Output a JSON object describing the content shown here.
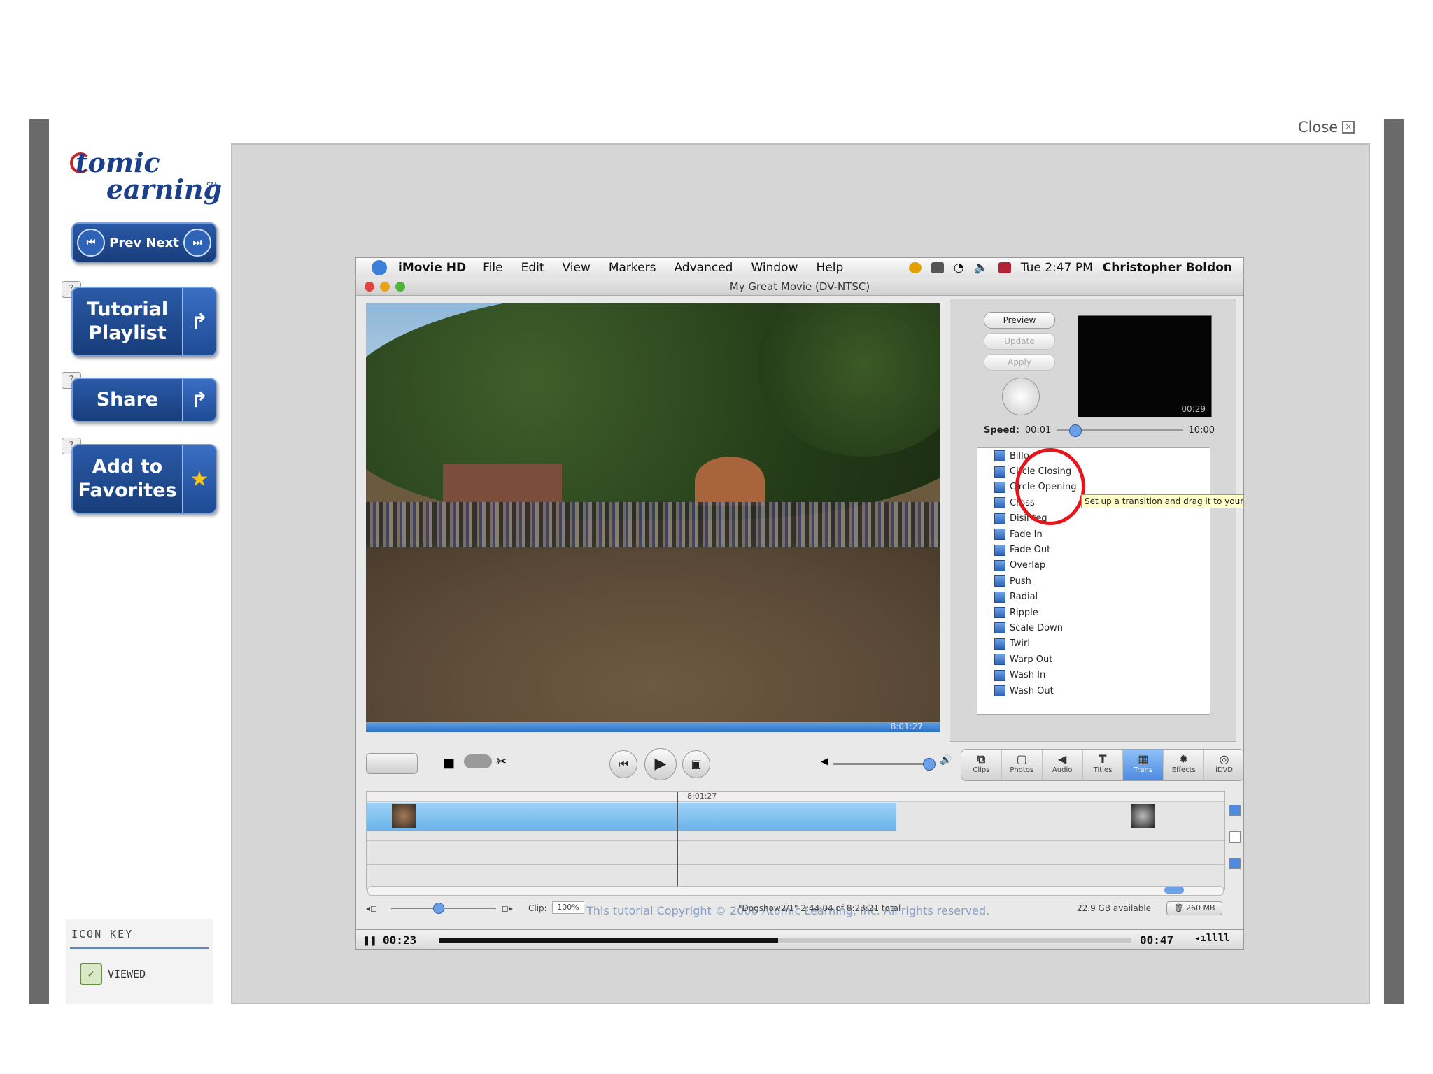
{
  "close": {
    "label": "Close"
  },
  "logo": {
    "line1": "tomic",
    "line2": "earning",
    "tm": "SM"
  },
  "pager": {
    "prev": "Prev",
    "next": "Next"
  },
  "buttons": {
    "tutorial": [
      "Tutorial",
      "Playlist"
    ],
    "share": "Share",
    "favorites": [
      "Add to",
      "Favorites"
    ]
  },
  "icon_key": {
    "title": "ICON KEY",
    "viewed": "VIEWED"
  },
  "mac_menu": {
    "app": "iMovie HD",
    "items": [
      "File",
      "Edit",
      "View",
      "Markers",
      "Advanced",
      "Window",
      "Help"
    ],
    "clock": "Tue 2:47 PM",
    "user": "Christopher Boldon"
  },
  "window": {
    "title": "My Great Movie (DV-NTSC)"
  },
  "viewer": {
    "timecode": "8:01:27"
  },
  "transitions_pane": {
    "buttons": {
      "preview": "Preview",
      "update": "Update",
      "apply": "Apply"
    },
    "preview_time": "00:29",
    "speed_label": "Speed:",
    "speed_value": "00:01",
    "speed_max": "10:00",
    "items": [
      "Billo",
      "Circle Closing",
      "Circle Opening",
      "Cross",
      "Disinteg",
      "Fade In",
      "Fade Out",
      "Overlap",
      "Push",
      "Radial",
      "Ripple",
      "Scale Down",
      "Twirl",
      "Warp Out",
      "Wash In",
      "Wash Out"
    ],
    "tooltip": "Set up a transition and drag it to your movie"
  },
  "pane_tabs": [
    "Clips",
    "Photos",
    "Audio",
    "Titles",
    "Trans",
    "Effects",
    "iDVD"
  ],
  "timeline": {
    "playhead": "8:01:27"
  },
  "statusbar": {
    "clip_label": "Clip:",
    "clip_zoom": "100%",
    "clip_info": "\"Dogshow2/1\"  2:44:04 of 8:23:21 total",
    "available": "22.9 GB available",
    "size": "260 MB",
    "copyright": "This tutorial Copyright © 2006 Atomic Learning, Inc. All rights reserved."
  },
  "player": {
    "current": "00:23",
    "total": "00:47",
    "progress": 0.49
  }
}
